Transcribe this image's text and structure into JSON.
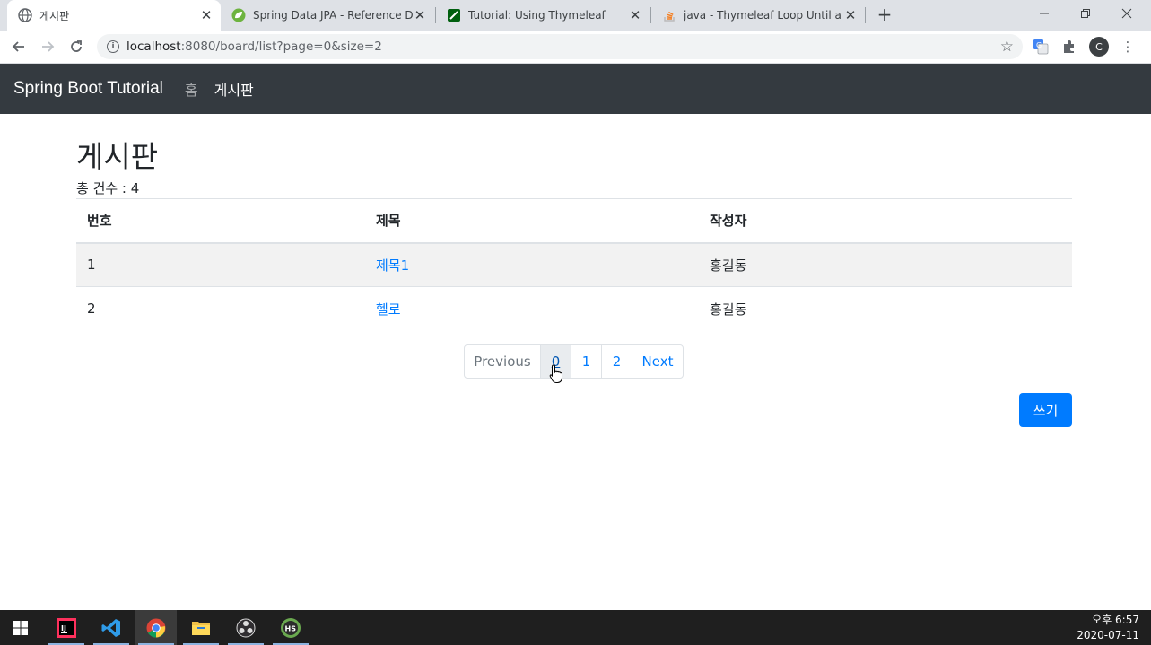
{
  "browser": {
    "tabs": [
      {
        "title": "게시판",
        "active": true
      },
      {
        "title": "Spring Data JPA - Reference Do",
        "active": false
      },
      {
        "title": "Tutorial: Using Thymeleaf",
        "active": false
      },
      {
        "title": "java - Thymeleaf Loop Until a N",
        "active": false
      }
    ],
    "url_host": "localhost",
    "url_path": ":8080/board/list?page=0&size=2",
    "profile_initial": "C"
  },
  "navbar": {
    "brand": "Spring Boot Tutorial",
    "links": [
      "홈",
      "게시판"
    ]
  },
  "main": {
    "heading": "게시판",
    "total_count": "총 건수 : 4",
    "table": {
      "headers": [
        "번호",
        "제목",
        "작성자"
      ],
      "rows": [
        {
          "no": "1",
          "title": "제목1",
          "author": "홍길동"
        },
        {
          "no": "2",
          "title": "헬로",
          "author": "홍길동"
        }
      ]
    },
    "pagination": [
      "Previous",
      "0",
      "1",
      "2",
      "Next"
    ],
    "write_button": "쓰기"
  },
  "taskbar": {
    "time": "오후 6:57",
    "date": "2020-07-11"
  },
  "colors": {
    "navbar_bg": "#343a40",
    "primary": "#007bff",
    "taskbar_bg": "#1f1f1f"
  }
}
